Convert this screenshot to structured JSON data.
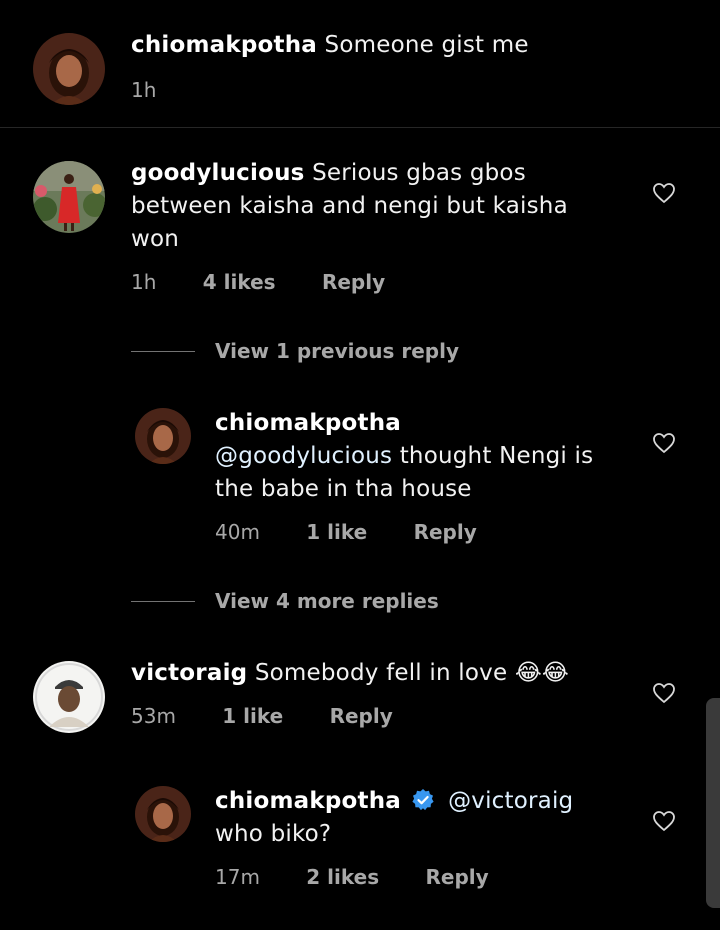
{
  "colors": {
    "background": "#000000",
    "text": "#f2f2f2",
    "meta": "#a8a8a8",
    "verified": "#3897f0"
  },
  "caption": {
    "username": "chiomakpotha",
    "text": "Someone gist me",
    "time": "1h"
  },
  "comments": [
    {
      "username": "goodylucious",
      "text_line1": "Serious gbas gbos",
      "text_line2": "between kaisha and nengi but kaisha",
      "text_line3": "won",
      "time": "1h",
      "likes": "4 likes",
      "reply": "Reply",
      "view_previous": "View 1 previous reply",
      "view_more": "View 4 more replies",
      "replies": [
        {
          "username": "chiomakpotha",
          "mention": "@goodylucious",
          "text_line2": "thought Nengi is",
          "text_line3": "the babe in tha house",
          "time": "40m",
          "likes": "1 like",
          "reply": "Reply"
        }
      ]
    },
    {
      "username": "victoraig",
      "text": "Somebody fell in love",
      "emoji": "😂😂",
      "time": "53m",
      "likes": "1 like",
      "reply": "Reply",
      "replies": [
        {
          "username": "chiomakpotha",
          "verified": true,
          "mention": "@victoraig",
          "text_line2": "who biko?",
          "time": "17m",
          "likes": "2 likes",
          "reply": "Reply"
        }
      ]
    }
  ]
}
